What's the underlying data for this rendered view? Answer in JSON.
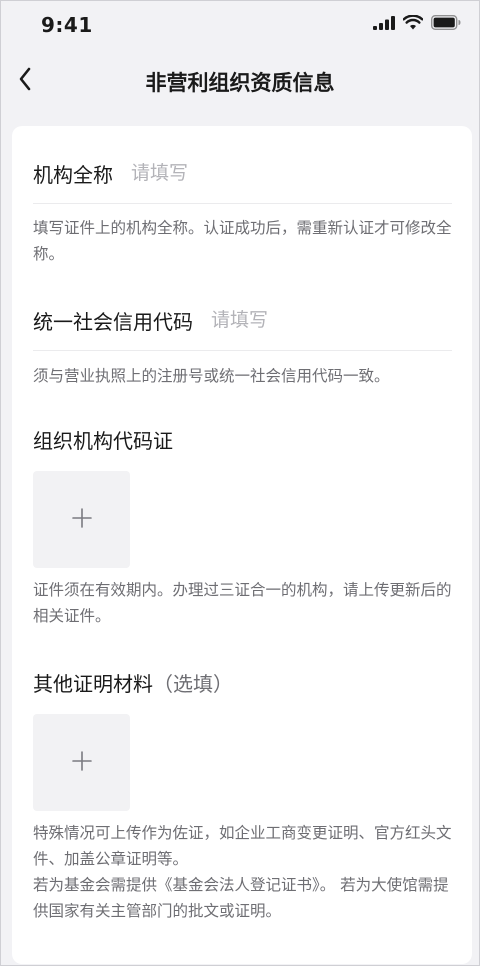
{
  "status_bar": {
    "time": "9:41"
  },
  "nav": {
    "title": "非营利组织资质信息"
  },
  "form": {
    "org_name": {
      "label": "机构全称",
      "placeholder": "请填写",
      "value": "",
      "hint": "填写证件上的机构全称。认证成功后，需重新认证才可修改全称。"
    },
    "credit_code": {
      "label": "统一社会信用代码",
      "placeholder": "请填写",
      "value": "",
      "hint": "须与营业执照上的注册号或统一社会信用代码一致。"
    },
    "org_code_cert": {
      "title": "组织机构代码证",
      "hint": "证件须在有效期内。办理过三证合一的机构，请上传更新后的相关证件。"
    },
    "other_materials": {
      "title": "其他证明材料",
      "optional": "（选填）",
      "hint_line1": "特殊情况可上传作为佐证，如企业工商变更证明、官方红头文件、加盖公章证明等。",
      "hint_line2": "若为基金会需提供《基金会法人登记证书》。 若为大使馆需提供国家有关主管部门的批文或证明。"
    }
  },
  "icons": {
    "back": "chevron-left-icon",
    "add": "plus-icon",
    "signal": "cellular-signal-icon",
    "wifi": "wifi-icon",
    "battery": "battery-icon"
  },
  "colors": {
    "background": "#f2f2f5",
    "card": "#ffffff",
    "text": "#1a1a1a",
    "hint": "#6e6e73",
    "placeholder": "#b3b3b8",
    "upload_bg": "#f2f2f4"
  }
}
